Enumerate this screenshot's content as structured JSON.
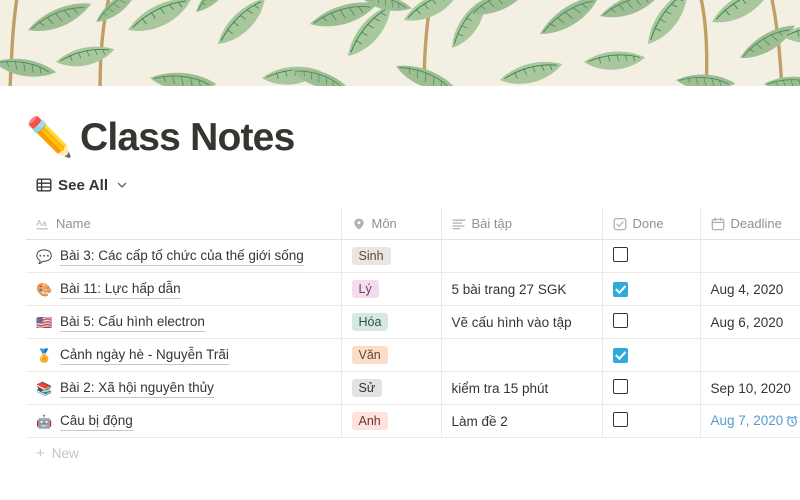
{
  "cover": {
    "name": "willow-bough-leaf-pattern",
    "background_color": "#f3efe3",
    "leaf_color": "#9cbd93",
    "vein_color": "#4e8f5e",
    "stem_color": "#b9935a"
  },
  "page": {
    "emoji": "✏️",
    "emoji_name": "pencil-emoji",
    "title": "Class Notes"
  },
  "view": {
    "icon": "table-icon",
    "label": "See All",
    "chevron": "chevron-down-icon"
  },
  "table": {
    "columns": [
      {
        "key": "name",
        "label": "Name",
        "icon": "text-aa-icon"
      },
      {
        "key": "mon",
        "label": "Môn",
        "icon": "select-tag-icon"
      },
      {
        "key": "baitap",
        "label": "Bài tập",
        "icon": "text-lines-icon"
      },
      {
        "key": "done",
        "label": "Done",
        "icon": "checkbox-icon"
      },
      {
        "key": "deadline",
        "label": "Deadline",
        "icon": "calendar-icon"
      }
    ],
    "rows": [
      {
        "emoji": "💬",
        "emoji_name": "speech-balloon-emoji",
        "name": "Bài 3: Các cấp tố chức của thế giới sống",
        "mon": "Sinh",
        "mon_bg": "#e9e5e3",
        "mon_fg": "#5d4b3c",
        "baitap": "",
        "done": false,
        "deadline": "",
        "deadline_reminder": false
      },
      {
        "emoji": "🎨",
        "emoji_name": "artist-palette-emoji",
        "name": "Bài 11: Lực hấp dẫn",
        "mon": "Lý",
        "mon_bg": "#f5dced",
        "mon_fg": "#6d3f63",
        "baitap": "5 bài trang 27 SGK",
        "done": true,
        "deadline": "Aug 4, 2020",
        "deadline_reminder": false
      },
      {
        "emoji": "🇺🇸",
        "emoji_name": "us-flag-emoji",
        "name": "Bài 5: Cấu hình electron",
        "mon": "Hóa",
        "mon_bg": "#d7e8e2",
        "mon_fg": "#28554a",
        "baitap": "Vẽ cấu hình vào tập",
        "done": false,
        "deadline": "Aug 6, 2020",
        "deadline_reminder": false
      },
      {
        "emoji": "🏅",
        "emoji_name": "sports-medal-emoji",
        "name": "Cảnh ngày hè - Nguyễn Trãi",
        "mon": "Văn",
        "mon_bg": "#fadec9",
        "mon_fg": "#6b4526",
        "baitap": "",
        "done": true,
        "deadline": "",
        "deadline_reminder": false
      },
      {
        "emoji": "📚",
        "emoji_name": "books-emoji",
        "name": "Bài 2: Xã hội nguyên thủy",
        "mon": "Sử",
        "mon_bg": "#e3e2e0",
        "mon_fg": "#37352f",
        "baitap": "kiểm tra 15 phút",
        "done": false,
        "deadline": "Sep 10, 2020",
        "deadline_reminder": false
      },
      {
        "emoji": "🤖",
        "emoji_name": "robot-emoji",
        "name": "Câu bị động",
        "mon": "Anh",
        "mon_bg": "#ffe2dd",
        "mon_fg": "#6e3630",
        "baitap": "Làm đề 2",
        "done": false,
        "deadline": "Aug 7, 2020",
        "deadline_reminder": true
      }
    ],
    "new_row_label": "New",
    "new_row_icon": "plus-icon"
  },
  "colors": {
    "accent_checkbox": "#2eaadc",
    "reminder_blue": "#529cca",
    "text": "#37352f",
    "muted_text": "#91918e",
    "row_border": "#eceae5"
  }
}
